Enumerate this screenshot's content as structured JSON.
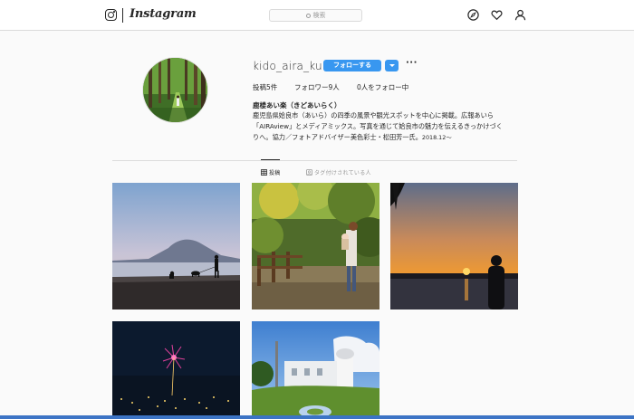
{
  "nav": {
    "wordmark": "Instagram",
    "search_placeholder": "検索",
    "icons": [
      "instagram-glyph-icon",
      "compass-icon",
      "heart-icon",
      "person-icon"
    ]
  },
  "profile": {
    "username": "kido_aira_ku",
    "follow_label": "フォローする",
    "more_label": "···",
    "stats": {
      "posts": "投稿5件",
      "followers": "フォロワー9人",
      "following": "0人をフォロー中"
    },
    "bio_name": "鹿楼あい楽（きどあいらく）",
    "bio_lines": [
      "鹿児島県姶良市（あいら）の四季の風景や観光スポットを中心に掲載。広報あいら",
      "「AIRAview」とメディアミックス。写真を通じて姶良市の魅力を伝えるきっかけづく",
      "りへ。協力／フォトアドバイザー美色彩士・松田芳一氏。"
    ],
    "bio_date": "2018.12〜"
  },
  "tabs": {
    "posts": "投稿",
    "tagged": "タグ付けされている人"
  },
  "posts": [
    {
      "subject": "sakurajima-beach-dog-walk"
    },
    {
      "subject": "forest-mother-child"
    },
    {
      "subject": "sunset-silhouette"
    },
    {
      "subject": "night-fireworks"
    },
    {
      "subject": "white-observatory-building"
    }
  ],
  "colors": {
    "accent": "#3897f0",
    "text": "#262626",
    "muted": "#999999",
    "border": "#dbdbdb",
    "background": "#fafafa"
  }
}
